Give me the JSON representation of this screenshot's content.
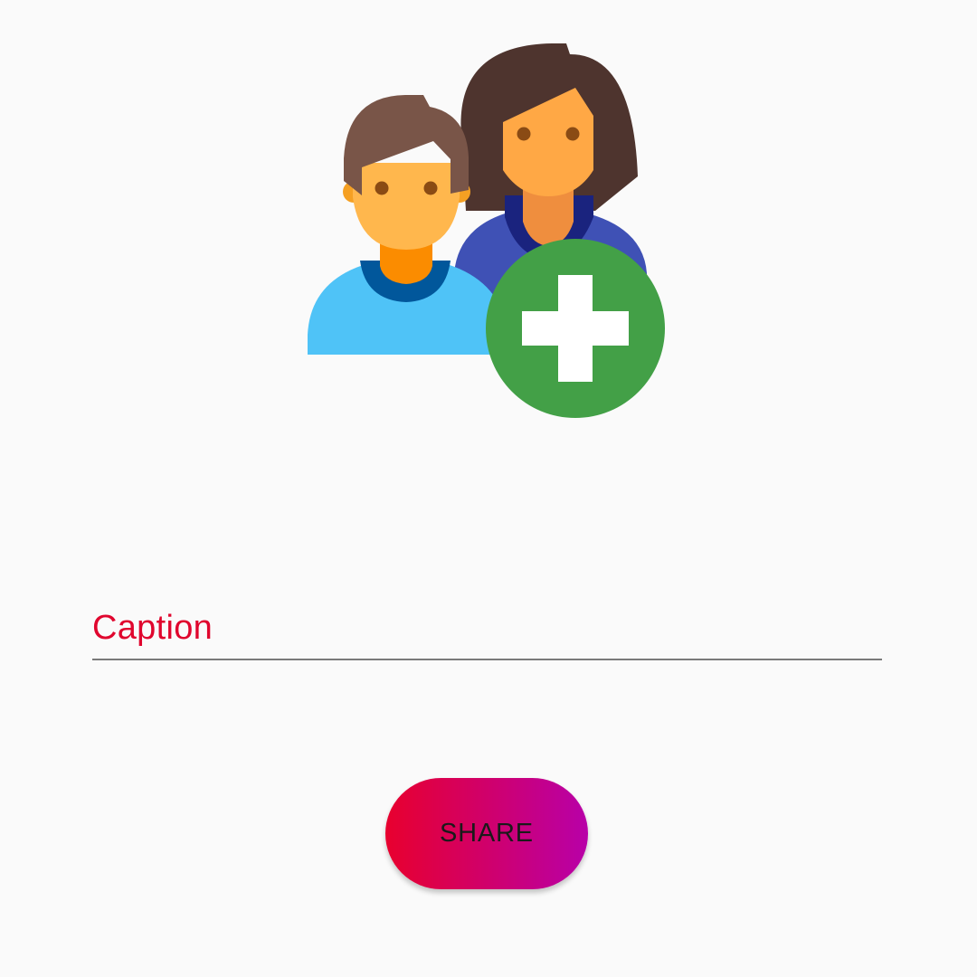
{
  "screen": {
    "illustration_icon": "add-group-icon",
    "caption": {
      "label": "Caption",
      "value": ""
    },
    "share_button": {
      "label": "SHARE"
    }
  },
  "colors": {
    "background": "#fafafa",
    "accent": "#e0062e",
    "button_gradient_start": "#e8002e",
    "button_gradient_end": "#b800a8",
    "add_badge": "#43a047"
  }
}
